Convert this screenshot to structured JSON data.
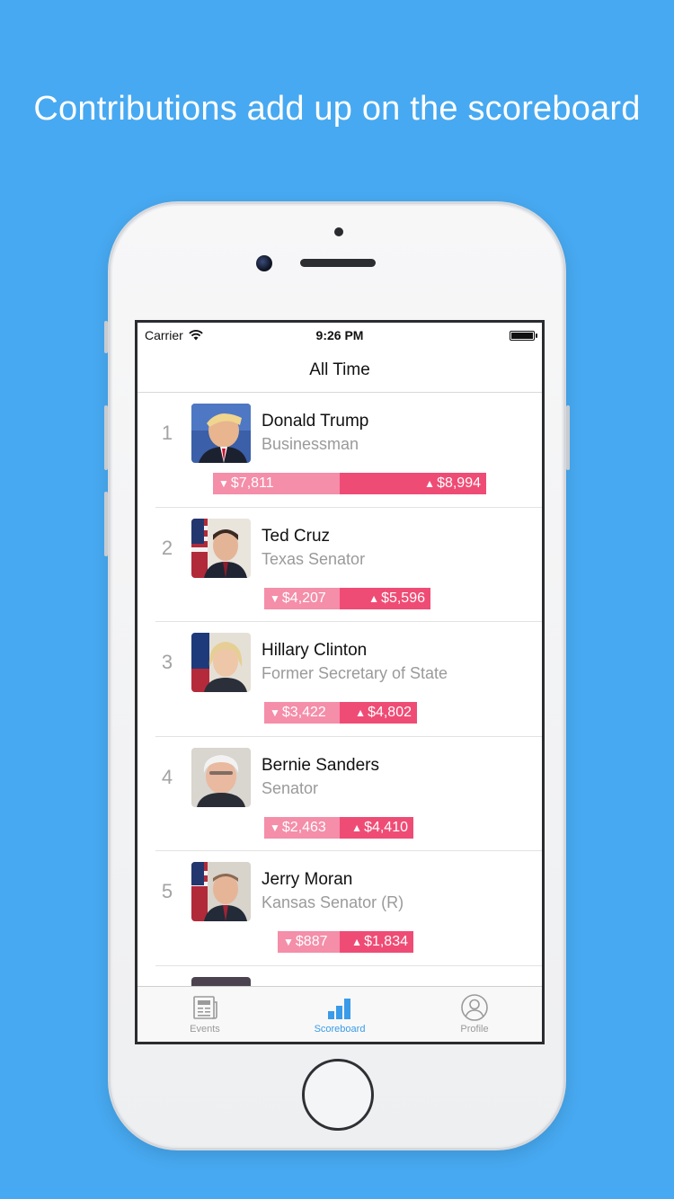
{
  "headline": "Contributions add up on the scoreboard",
  "status_bar": {
    "carrier": "Carrier",
    "time": "9:26 PM"
  },
  "nav": {
    "title": "All Time"
  },
  "rows": [
    {
      "rank": "1",
      "name": "Donald Trump",
      "title": "Businessman",
      "down": "$7,811",
      "up": "$8,994",
      "avatar": "trump-photo"
    },
    {
      "rank": "2",
      "name": "Ted Cruz",
      "title": "Texas Senator",
      "down": "$4,207",
      "up": "$5,596",
      "avatar": "cruz-photo"
    },
    {
      "rank": "3",
      "name": "Hillary Clinton",
      "title": "Former Secretary of State",
      "down": "$3,422",
      "up": "$4,802",
      "avatar": "clinton-photo"
    },
    {
      "rank": "4",
      "name": "Bernie Sanders",
      "title": "Senator",
      "down": "$2,463",
      "up": "$4,410",
      "avatar": "sanders-photo"
    },
    {
      "rank": "5",
      "name": "Jerry Moran",
      "title": "Kansas Senator (R)",
      "down": "$887",
      "up": "$1,834",
      "avatar": "moran-photo"
    }
  ],
  "tabs": [
    {
      "label": "Events",
      "icon": "newspaper-icon",
      "active": false
    },
    {
      "label": "Scoreboard",
      "icon": "bar-chart-icon",
      "active": true
    },
    {
      "label": "Profile",
      "icon": "person-icon",
      "active": false
    }
  ],
  "colors": {
    "background": "#47a9f1",
    "down_bar": "#f48ea9",
    "up_bar": "#ef4c75",
    "active_tab": "#3a9be8"
  }
}
